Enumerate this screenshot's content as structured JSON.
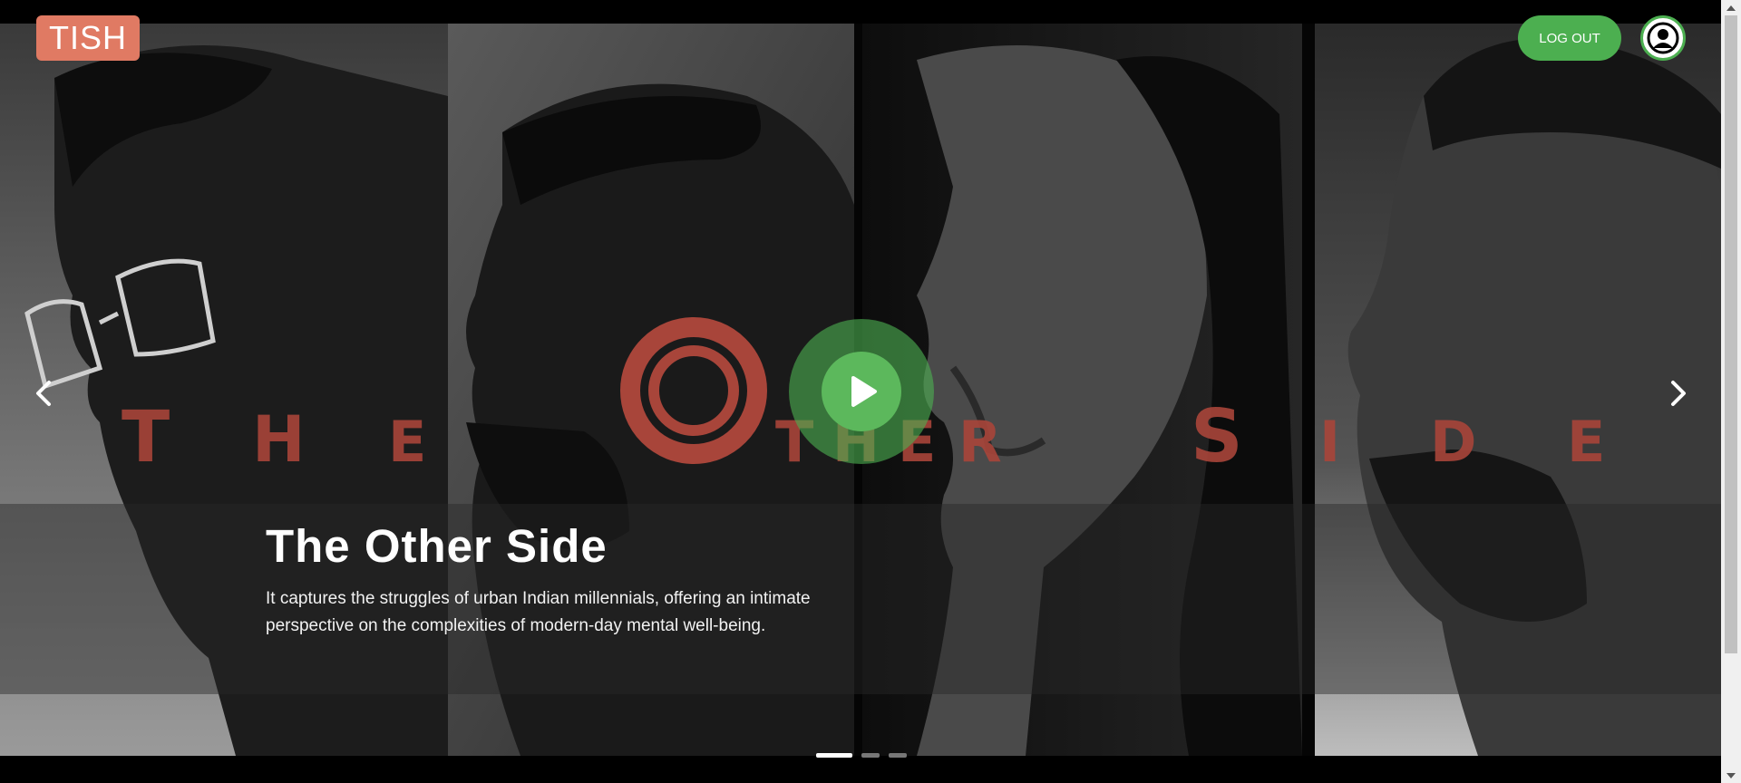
{
  "header": {
    "logo_text": "TISH",
    "logout_label": "LOG OUT",
    "avatar_icon": "user-circle-icon"
  },
  "hero": {
    "title_art_letters": [
      "T",
      "H",
      "E",
      "O",
      "T",
      "H",
      "E",
      "R",
      "S",
      "I",
      "D",
      "E"
    ],
    "title": "The Other Side",
    "description": "It captures the struggles of urban Indian millennials, offering an intimate perspective on the complexities of modern-day mental well-being.",
    "play_icon": "play-icon",
    "prev_icon": "chevron-left-icon",
    "next_icon": "chevron-right-icon"
  },
  "carousel": {
    "slide_count": 3,
    "active_index": 0
  },
  "colors": {
    "brand_logo": "#e07a63",
    "accent_green": "#4caf50",
    "title_art_red": "#a8453a"
  }
}
